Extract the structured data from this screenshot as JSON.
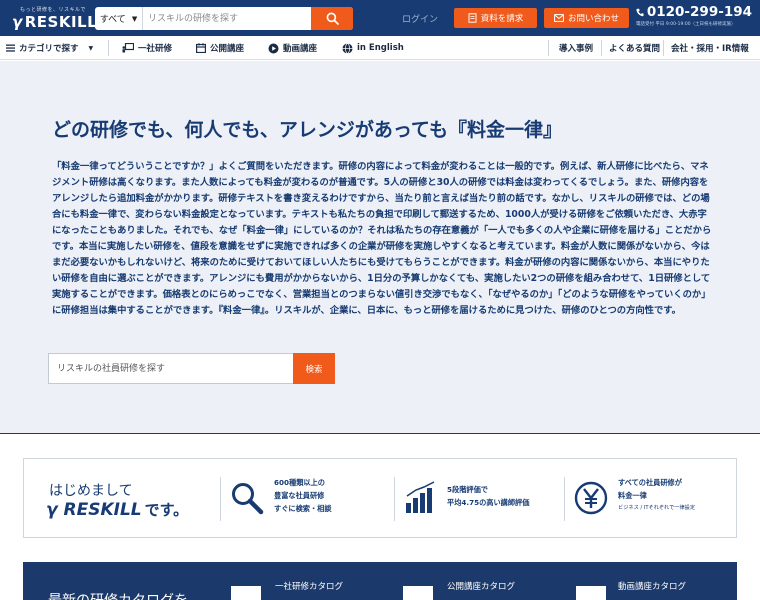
{
  "header": {
    "logo_tagline": "もっと研修を、リスキルで",
    "logo_text": "RESKILL",
    "search": {
      "category": "すべて",
      "placeholder": "リスキルの研修を探す"
    },
    "login": "ログイン",
    "request_docs": "資料を請求",
    "contact": "お問い合わせ",
    "phone": "0120-299-194",
    "phone_hours": "電話受付 平日 9:00-19:00（土日祝も研修実施）"
  },
  "nav": {
    "categories": "カテゴリで探す",
    "items": [
      "一社研修",
      "公開講座",
      "動画講座",
      "in English"
    ],
    "right_items": [
      "導入事例",
      "よくある質問",
      "会社・採用・IR情報"
    ]
  },
  "hero": {
    "title": "どの研修でも、何人でも、アレンジがあっても『料金一律』",
    "body": "「料金一律ってどういうことですか？」よくご質問をいただきます。研修の内容によって料金が変わることは一般的です。例えば、新人研修に比べたら、マネジメント研修は高くなります。また人数によっても料金が変わるのが普通です。5人の研修と30人の研修では料金は変わってくるでしょう。また、研修内容をアレンジしたら追加料金がかかります。研修テキストを書き変えるわけですから、当たり前と言えば当たり前の話です。なかし、リスキルの研修では、どの場合にも料金一律で、変わらない料金設定となっています。テキストも私たちの負担で印刷して郵送するため、1000人が受ける研修をご依頼いただき、大赤字になったこともありました。それでも、なぜ「料金一律」にしているのか？それは私たちの存在意義が「一人でも多くの人や企業に研修を届ける」ことだからです。本当に実施したい研修を、値段を意識をせずに実施できれば多くの企業が研修を実施しやすくなると考えています。料金が人数に関係がないから、今はまだ必要ないかもしれないけど、将来のために受けておいてほしい人たちにも受けてもらうことができます。料金が研修の内容に関係ないから、本当にやりたい研修を自由に選ぶことができます。アレンジにも費用がかからないから、1日分の予算しかなくても、実施したい2つの研修を組み合わせて、1日研修として実施することができます。価格表とのにらめっこでなく、営業担当とのつまらない値引き交渉でもなく、「なぜやるのか」「どのような研修をやっていくのか」に研修担当は集中することができます。『料金一律』。リスキルが、企業に、日本に、もっと研修を届けるために見つけた、研修のひとつの方向性です。",
    "search_placeholder": "リスキルの社員研修を探す",
    "search_button": "検索"
  },
  "intro": {
    "hello": "はじめまして",
    "brand": "RESKILL",
    "desu": "です。",
    "features": [
      {
        "icon": "magnifier-icon",
        "lines": [
          "600種類以上の",
          "豊富な社員研修",
          "すぐに検索・相談"
        ],
        "sub": ""
      },
      {
        "icon": "bar-chart-icon",
        "lines": [
          "5段階評価で",
          "平均4.75の高い講師評価"
        ],
        "sub": ""
      },
      {
        "icon": "yen-icon",
        "lines": [
          "すべての社員研修が",
          "料金一律"
        ],
        "sub": "ビジネス / ITそれぞれで一律設定"
      }
    ]
  },
  "catalog": {
    "lead": "最新の研修カタログを",
    "items": [
      "一社研修カタログ",
      "公開講座カタログ",
      "動画講座カタログ"
    ]
  },
  "colors": {
    "navy": "#173b72",
    "orange": "#f05a1a",
    "hero_bg": "#edf1f7"
  }
}
